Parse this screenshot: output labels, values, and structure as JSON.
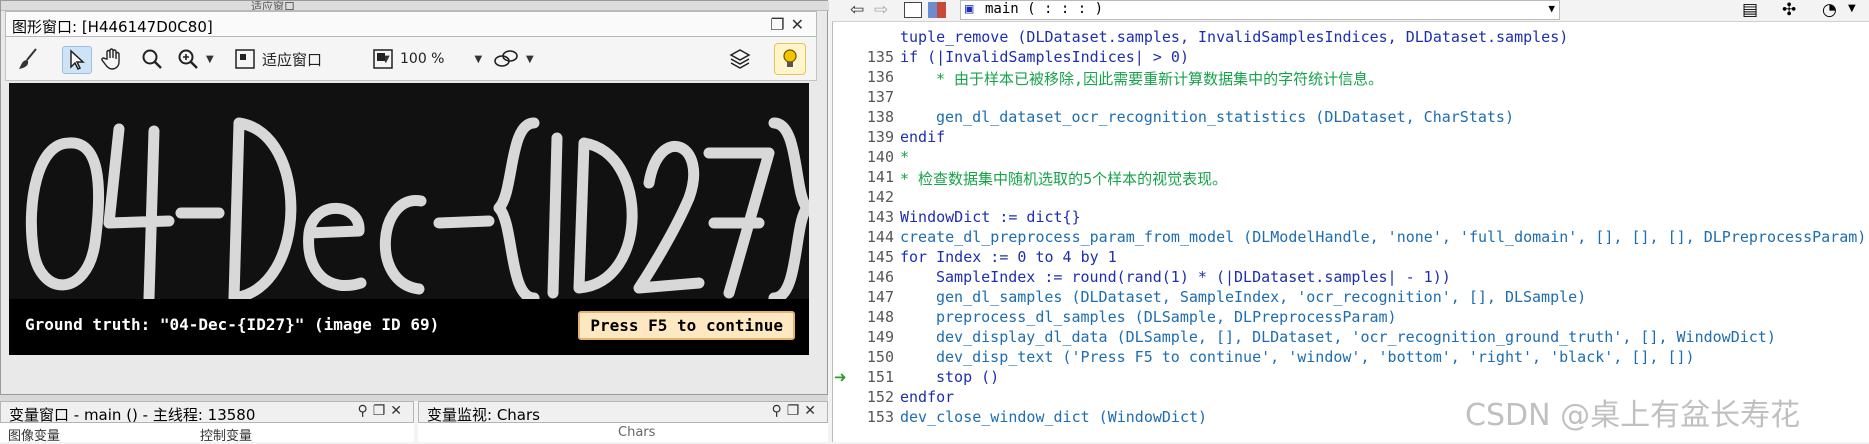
{
  "graphics_window": {
    "title": "图形窗口: [H446147D0C80]",
    "top_strip_text": "适应窗口",
    "toolbar": {
      "fit_label": "适应窗口",
      "zoom_label": "100 %"
    },
    "image_text": "04-Dec-{ID27}",
    "ground_truth_label": "Ground truth: \"04-Dec-{ID27}\" (image ID 69)",
    "continue_label": "Press F5 to continue"
  },
  "variable_window": {
    "title": "变量窗口 - main () - 主线程: 13580",
    "col_image": "图像变量",
    "col_control": "控制变量"
  },
  "variable_watch": {
    "title": "变量监视: Chars",
    "col": "Chars"
  },
  "editor": {
    "procedure_selector": "main ( : : : )",
    "lines": [
      {
        "n": "",
        "text": "tuple_remove (DLDataset.samples, InvalidSamplesIndices, DLDataset.samples)",
        "cls": "plain",
        "indent": 0
      },
      {
        "n": "135",
        "text": "if (|InvalidSamplesIndices| > 0)",
        "cls": "kw",
        "indent": 0
      },
      {
        "n": "136",
        "text": "* 由于样本已被移除,因此需要重新计算数据集中的字符统计信息。",
        "cls": "cmt",
        "indent": 1
      },
      {
        "n": "137",
        "text": "",
        "cls": "plain",
        "indent": 0
      },
      {
        "n": "138",
        "text": "gen_dl_dataset_ocr_recognition_statistics (DLDataset, CharStats)",
        "cls": "fn",
        "indent": 1
      },
      {
        "n": "139",
        "text": "endif",
        "cls": "kw",
        "indent": 0
      },
      {
        "n": "140",
        "text": "*",
        "cls": "cmt",
        "indent": 0
      },
      {
        "n": "141",
        "text": "* 检查数据集中随机选取的5个样本的视觉表现。",
        "cls": "cmt",
        "indent": 0
      },
      {
        "n": "142",
        "text": "",
        "cls": "plain",
        "indent": 0
      },
      {
        "n": "143",
        "text": "WindowDict := dict{}",
        "cls": "plain",
        "indent": 0
      },
      {
        "n": "144",
        "text": "create_dl_preprocess_param_from_model (DLModelHandle, 'none', 'full_domain', [], [], [], DLPreprocessParam)",
        "cls": "fn",
        "indent": 0
      },
      {
        "n": "145",
        "text": "for Index := 0 to 4 by 1",
        "cls": "kw",
        "indent": 0
      },
      {
        "n": "146",
        "text": "SampleIndex := round(rand(1) * (|DLDataset.samples| - 1))",
        "cls": "plain",
        "indent": 1
      },
      {
        "n": "147",
        "text": "gen_dl_samples (DLDataset, SampleIndex, 'ocr_recognition', [], DLSample)",
        "cls": "fn",
        "indent": 1
      },
      {
        "n": "148",
        "text": "preprocess_dl_samples (DLSample, DLPreprocessParam)",
        "cls": "fn",
        "indent": 1
      },
      {
        "n": "149",
        "text": "dev_display_dl_data (DLSample, [], DLDataset, 'ocr_recognition_ground_truth', [], WindowDict)",
        "cls": "fn",
        "indent": 1
      },
      {
        "n": "150",
        "text": "dev_disp_text ('Press F5 to continue', 'window', 'bottom', 'right', 'black', [], [])",
        "cls": "fn",
        "indent": 1
      },
      {
        "n": "151",
        "text": "stop ()",
        "cls": "kw",
        "indent": 1
      },
      {
        "n": "152",
        "text": "endfor",
        "cls": "kw",
        "indent": 0
      },
      {
        "n": "153",
        "text": "dev_close_window_dict (WindowDict)",
        "cls": "fn",
        "indent": 0
      }
    ]
  },
  "watermark": "CSDN @桌上有盆长寿花",
  "colors": {
    "comment": "#16a34a",
    "keyword": "#1d2fb0",
    "accent": "#f5c400"
  }
}
